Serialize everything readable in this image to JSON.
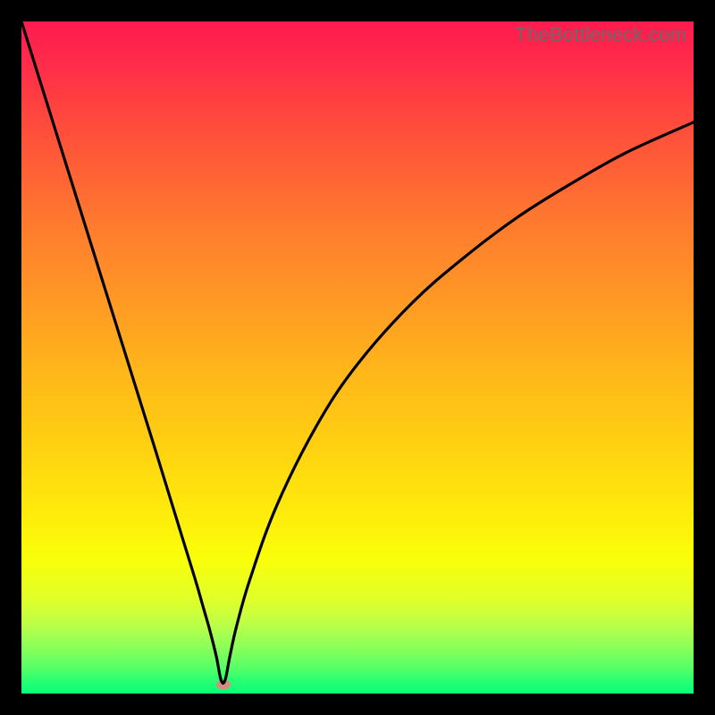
{
  "watermark": "TheBottleneck.com",
  "colors": {
    "page_bg": "#000000",
    "gradient_top": "#ff1a4f",
    "gradient_bottom": "#08ff78",
    "curve": "#000000",
    "dot": "#d98a82",
    "watermark_text": "#6a6a6a"
  },
  "chart_data": {
    "type": "line",
    "title": "",
    "xlabel": "",
    "ylabel": "",
    "xlim": [
      0,
      100
    ],
    "ylim": [
      0,
      100
    ],
    "grid": false,
    "series": [
      {
        "name": "curve",
        "x": [
          0,
          5,
          10,
          15,
          20,
          24,
          26,
          27,
          28,
          29,
          29.7,
          30.3,
          31,
          32,
          34,
          38,
          44,
          50,
          58,
          66,
          74,
          82,
          90,
          100
        ],
        "values": [
          100,
          84,
          68,
          52,
          36,
          23,
          16.5,
          13,
          9.5,
          5.5,
          2,
          2,
          5.5,
          10,
          17,
          28,
          40,
          49,
          58,
          65,
          71,
          76,
          80.5,
          85
        ]
      }
    ],
    "minimum_marker": {
      "x": 30,
      "y": 1.3
    }
  }
}
